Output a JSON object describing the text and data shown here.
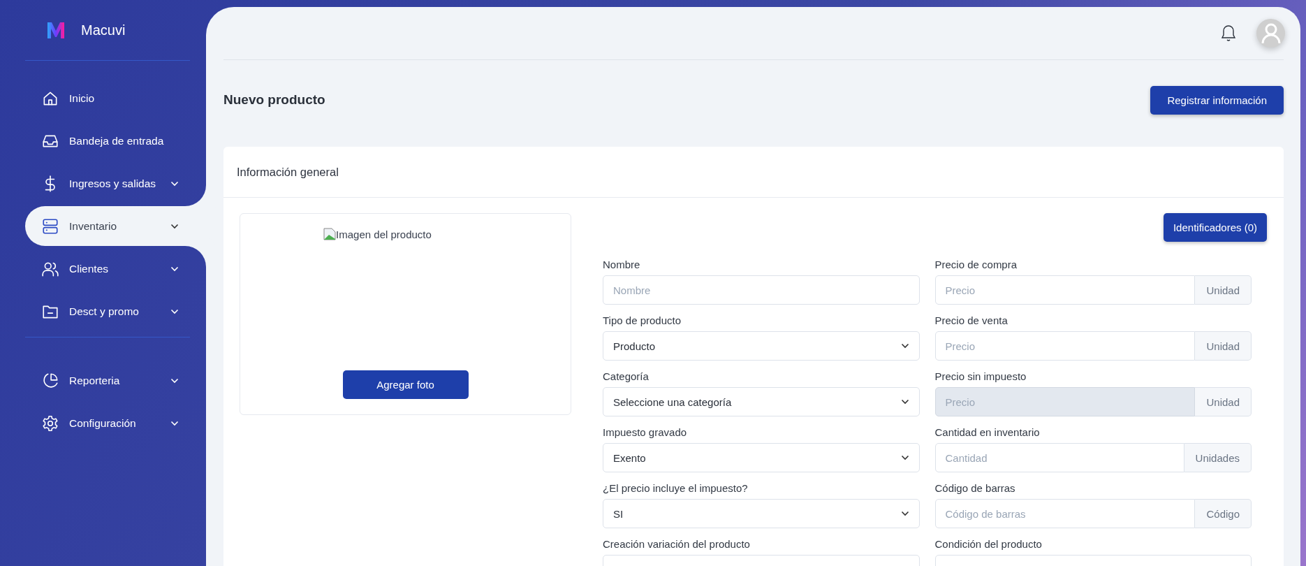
{
  "brand": {
    "name": "Macuvi"
  },
  "sidebar": {
    "items": [
      {
        "label": "Inicio",
        "expandable": false,
        "selected": false
      },
      {
        "label": "Bandeja de entrada",
        "expandable": false,
        "selected": false
      },
      {
        "label": "Ingresos y salidas",
        "expandable": true,
        "selected": false
      },
      {
        "label": "Inventario",
        "expandable": true,
        "selected": true
      },
      {
        "label": "Clientes",
        "expandable": true,
        "selected": false
      },
      {
        "label": "Desct y promo",
        "expandable": true,
        "selected": false
      }
    ],
    "bottom_items": [
      {
        "label": "Reporteria",
        "expandable": true,
        "selected": false
      },
      {
        "label": "Configuración",
        "expandable": true,
        "selected": false
      }
    ]
  },
  "page": {
    "title": "Nuevo producto",
    "primary_button": "Registrar información"
  },
  "card": {
    "title": "Información general",
    "photo": {
      "alt_text": "Imagen del producto",
      "button": "Agregar foto"
    },
    "identifiers_button": "Identificadores (0)",
    "left_fields": [
      {
        "label": "Nombre",
        "kind": "text",
        "placeholder": "Nombre"
      },
      {
        "label": "Tipo de producto",
        "kind": "select",
        "value": "Producto"
      },
      {
        "label": "Categoría",
        "kind": "select",
        "value": "Seleccione una categoría"
      },
      {
        "label": "Impuesto gravado",
        "kind": "select",
        "value": "Exento"
      },
      {
        "label": "¿El precio incluye el impuesto?",
        "kind": "select",
        "value": "SI"
      },
      {
        "label": "Creación variación del producto",
        "kind": "blank"
      }
    ],
    "right_fields": [
      {
        "label": "Precio de compra",
        "kind": "addon",
        "placeholder": "Precio",
        "addon": "Unidad",
        "disabled": false
      },
      {
        "label": "Precio de venta",
        "kind": "addon",
        "placeholder": "Precio",
        "addon": "Unidad",
        "disabled": false
      },
      {
        "label": "Precio sin impuesto",
        "kind": "addon",
        "placeholder": "Precio",
        "addon": "Unidad",
        "disabled": true
      },
      {
        "label": "Cantidad en inventario",
        "kind": "addon",
        "placeholder": "Cantidad",
        "addon": "Unidades",
        "disabled": false
      },
      {
        "label": "Código de barras",
        "kind": "addon",
        "placeholder": "Código de barras",
        "addon": "Código",
        "disabled": false
      },
      {
        "label": "Condición del producto",
        "kind": "blank"
      }
    ]
  }
}
